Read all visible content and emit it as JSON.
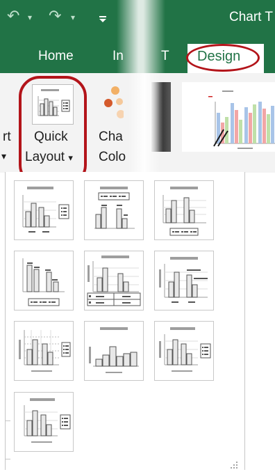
{
  "window": {
    "title_fragment": "Chart T"
  },
  "quick_access": {
    "undo_icon": "undo-icon",
    "redo_icon": "redo-icon",
    "customize_icon": "customize-qat-icon"
  },
  "tabs": [
    {
      "label": "Home"
    },
    {
      "label": "In"
    },
    {
      "label": "T"
    },
    {
      "label": "Design",
      "active": true
    }
  ],
  "ribbon": {
    "left_fragment_top": "rt",
    "left_fragment_bottom": "▾",
    "quick_layout_line1": "Quick",
    "quick_layout_line2": "Layout",
    "quick_layout_dropdown": "▾",
    "change_colors_line1": "Cha",
    "change_colors_line2": "Colo"
  },
  "gallery": {
    "layouts": [
      {
        "name": "layout-1"
      },
      {
        "name": "layout-2"
      },
      {
        "name": "layout-3"
      },
      {
        "name": "layout-4"
      },
      {
        "name": "layout-5"
      },
      {
        "name": "layout-6"
      },
      {
        "name": "layout-7"
      },
      {
        "name": "layout-8"
      },
      {
        "name": "layout-9"
      },
      {
        "name": "layout-10"
      }
    ]
  },
  "colors": {
    "excel_green": "#217346",
    "highlight_red": "#b3141a"
  }
}
